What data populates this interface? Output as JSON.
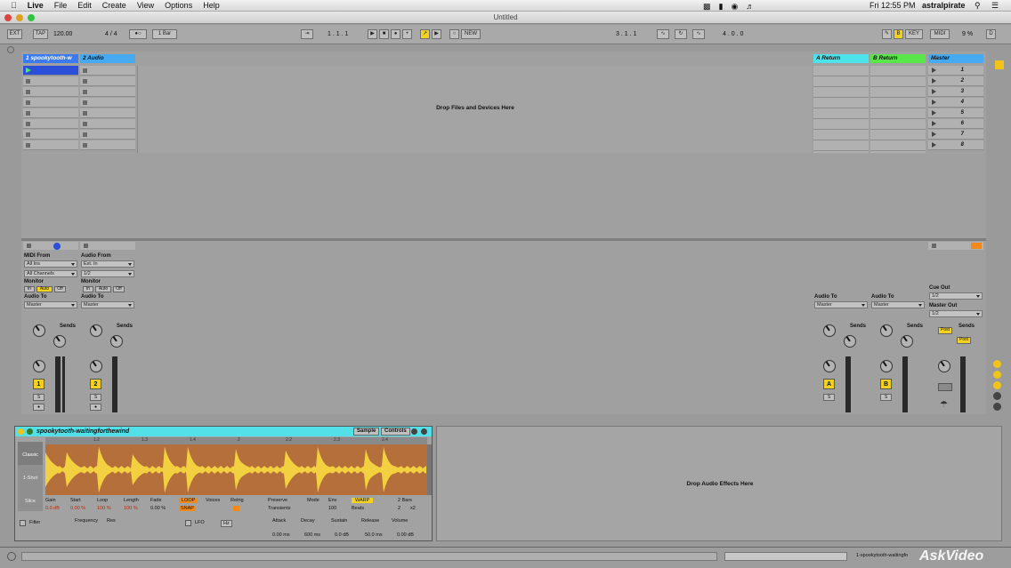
{
  "menubar": {
    "app": "Live",
    "items": [
      "File",
      "Edit",
      "Create",
      "View",
      "Options",
      "Help"
    ],
    "clock": "Fri 12:55 PM",
    "user": "astralpirate"
  },
  "window": {
    "title": "Untitled"
  },
  "control": {
    "ext": "EXT",
    "tap": "TAP",
    "tempo": "120.00",
    "sig": "4 / 4",
    "quant": "1 Bar",
    "pos": "1 . 1 . 1",
    "new": "NEW",
    "loop_pos": "3 . 1 . 1",
    "loop_len": "4 . 0 . 0",
    "key": "KEY",
    "midi": "MIDI",
    "cpu": "9 %",
    "d": "D"
  },
  "tracks": [
    {
      "name": "1 spookytooth-w",
      "color": "#3a7cf0"
    },
    {
      "name": "2 Audio",
      "color": "#47a9f0"
    }
  ],
  "returns": [
    {
      "name": "A Return",
      "color": "#4ce3ea"
    },
    {
      "name": "B Return",
      "color": "#58e64a"
    },
    {
      "name": "Master",
      "color": "#47a9f0"
    }
  ],
  "scenes": [
    "1",
    "2",
    "3",
    "4",
    "5",
    "6",
    "7",
    "8"
  ],
  "drop_files": "Drop Files and Devices Here",
  "io": {
    "midi_from": "MIDI From",
    "all_ins": "All Ins",
    "all_channels": "All Channels",
    "audio_from": "Audio From",
    "ext_in": "Ext. In",
    "ch": "1/2",
    "monitor": "Monitor",
    "in": "In",
    "auto": "Auto",
    "off": "Off",
    "audio_to": "Audio To",
    "master": "Master",
    "sends": "Sends",
    "cue_out": "Cue Out",
    "master_out": "Master Out",
    "post": "Post"
  },
  "track_numbers": [
    "1",
    "2"
  ],
  "return_letters": [
    "A",
    "B"
  ],
  "solo": "S",
  "clip": {
    "name": "spookytooth-waitingforthewind",
    "sample": "Sample",
    "controls": "Controls",
    "classic": "Classic",
    "oneshot": "1-Shot",
    "slice": "Slice",
    "labels": [
      "Gain",
      "Start",
      "Loop",
      "Length",
      "Fade",
      "LOOP",
      "Voices",
      "Retrig",
      "Preserve",
      "Mode",
      "Env",
      "WARP",
      "2 Bars"
    ],
    "values": [
      "0.0 dB",
      "0.00 %",
      "100 %",
      "100 %",
      "0.00 %",
      "SNAP",
      "Transients",
      "100",
      "Beats",
      "2",
      "x2"
    ],
    "ruler": [
      "1.2",
      "1.3",
      "1.4",
      "2",
      "2.2",
      "2.3",
      "2.4"
    ],
    "filter": "Filter",
    "frequency": "Frequency",
    "res": "Res",
    "lfo": "LFO",
    "hz": "Hz",
    "env_labels": [
      "Attack",
      "Decay",
      "Sustain",
      "Release",
      "Volume"
    ],
    "env_values": [
      "0.00 ms",
      "600 ms",
      "0.0 dB",
      "50.0 ms",
      "0.00 dB"
    ]
  },
  "drop_fx": "Drop Audio Effects Here",
  "status_clip": "1-spookytooth-waitingfo",
  "watermark": "AskVideo"
}
